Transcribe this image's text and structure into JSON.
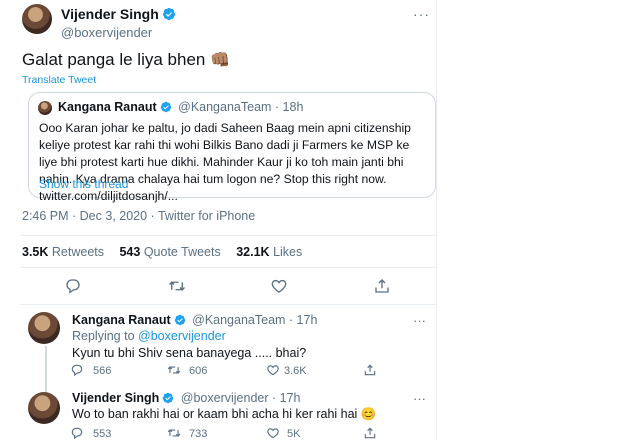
{
  "main_tweet": {
    "author_name": "Vijender Singh",
    "handle": "@boxervijender",
    "text": "Galat panga le liya bhen",
    "emoji": "👊🏽",
    "translate": "Translate Tweet",
    "timestamp": "2:46 PM · Dec 3, 2020 · Twitter for iPhone"
  },
  "quoted_tweet": {
    "author_name": "Kangana Ranaut",
    "handle": "@KanganaTeam",
    "age": "· 18h",
    "text": "Ooo Karan johar ke paltu, jo dadi Saheen Baag mein apni citizenship keliye protest kar rahi thi wohi Bilkis Bano dadi ji Farmers ke MSP ke liye bhi protest karti hue dikhi. Mahinder Kaur ji ko toh main janti bhi nahin. Kya drama chalaya hai tum logon ne? Stop this right now. twitter.com/diljitdosanjh/...",
    "show_thread": "Show this thread"
  },
  "stats": {
    "retweets_count": "3.5K",
    "retweets_label": "Retweets",
    "quotes_count": "543",
    "quotes_label": "Quote Tweets",
    "likes_count": "32.1K",
    "likes_label": "Likes"
  },
  "replies": [
    {
      "author_name": "Kangana Ranaut",
      "handle": "@KanganaTeam",
      "age": "· 17h",
      "replying_prefix": "Replying to",
      "replying_to": "@boxervijender",
      "text": "Kyun tu bhi Shiv sena banayega ..... bhai?",
      "reply_count": "566",
      "retweet_count": "606",
      "like_count": "3.6K"
    },
    {
      "author_name": "Vijender Singh",
      "handle": "@boxervijender",
      "age": "· 17h",
      "text": "Wo to ban rakhi hai or kaam bhi acha hi ker rahi hai",
      "emoji": "😊",
      "reply_count": "553",
      "retweet_count": "733",
      "like_count": "5K"
    }
  ],
  "icons": [
    "more-icon",
    "verified-icon",
    "reply-icon",
    "retweet-icon",
    "like-icon",
    "share-icon"
  ],
  "colors": {
    "accent": "#1b95e0",
    "muted": "#5b7083",
    "border": "#e6ecf0"
  }
}
